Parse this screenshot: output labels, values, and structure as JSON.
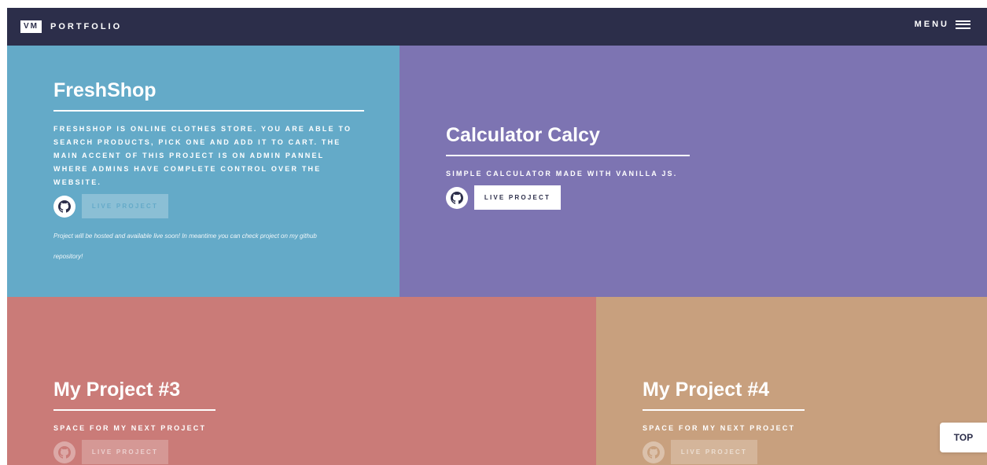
{
  "nav": {
    "logo": "VM",
    "brand": "PORTFOLIO",
    "menu_label": "MENU"
  },
  "projects": [
    {
      "title": "FreshShop",
      "description": "FRESHSHOP IS ONLINE CLOTHES STORE. YOU ARE ABLE TO SEARCH PRODUCTS, PICK ONE AND ADD IT TO CART. THE MAIN ACCENT OF THIS PROJECT IS ON ADMIN PANNEL WHERE ADMINS HAVE COMPLETE CONTROL OVER THE WEBSITE.",
      "live_label": "LIVE PROJECT",
      "note": "Project will be hosted and available live soon! In meantime you can check project on my github repository!",
      "color": "#64aac8"
    },
    {
      "title": "Calculator Calcy",
      "description": "SIMPLE CALCULATOR MADE WITH VANILLA JS.",
      "live_label": "LIVE PROJECT",
      "color": "#7d74b2"
    },
    {
      "title": "My Project #3",
      "description": "SPACE FOR MY NEXT PROJECT",
      "live_label": "LIVE PROJECT",
      "color": "#ca7b78"
    },
    {
      "title": "My Project #4",
      "description": "SPACE FOR MY NEXT PROJECT",
      "live_label": "LIVE PROJECT",
      "color": "#c8a07e"
    }
  ],
  "icons": {
    "github": "github-icon",
    "menu": "hamburger-menu-icon"
  },
  "top_button": "TOP",
  "colors": {
    "navbar": "#2c2e4a",
    "text": "#ffffff"
  }
}
